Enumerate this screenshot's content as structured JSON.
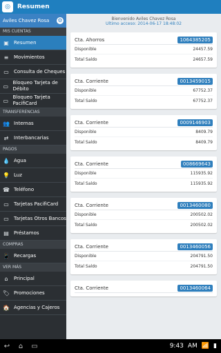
{
  "appbar": {
    "title": "Resumen",
    "logo_icon": "app-logo-icon"
  },
  "sidebar": {
    "user_name": "Aviles Chavez Rosa",
    "sections": [
      {
        "label": "MIS CUENTAS",
        "items": [
          {
            "label": "Resumen",
            "icon": "wallet-icon",
            "active": true
          },
          {
            "label": "Movimientos",
            "icon": "list-icon"
          },
          {
            "label": "Consulta de Cheques",
            "icon": "cheque-icon"
          },
          {
            "label": "Bloqueo Tarjeta de Débito",
            "icon": "card-icon"
          },
          {
            "label": "Bloqueo Tarjeta PacifiCard",
            "icon": "card-icon"
          }
        ]
      },
      {
        "label": "TRANSFERENCIAS",
        "items": [
          {
            "label": "Internas",
            "icon": "people-icon"
          },
          {
            "label": "Interbancarias",
            "icon": "transfer-icon"
          }
        ]
      },
      {
        "label": "PAGOS",
        "items": [
          {
            "label": "Agua",
            "icon": "drop-icon"
          },
          {
            "label": "Luz",
            "icon": "bulb-icon"
          },
          {
            "label": "Teléfono",
            "icon": "phone-icon"
          },
          {
            "label": "Tarjetas PacifiCard",
            "icon": "card-icon"
          },
          {
            "label": "Tarjetas Otros Bancos",
            "icon": "card-icon"
          },
          {
            "label": "Préstamos",
            "icon": "loan-icon"
          }
        ]
      },
      {
        "label": "COMPRAS",
        "items": [
          {
            "label": "Recargas",
            "icon": "mobile-icon"
          }
        ]
      },
      {
        "label": "VER MÁS",
        "items": [
          {
            "label": "Principal",
            "icon": "home-icon"
          },
          {
            "label": "Promociones",
            "icon": "tag-icon"
          },
          {
            "label": "Agencias y Cajeros",
            "icon": "house-icon"
          }
        ]
      }
    ]
  },
  "main": {
    "welcome": "Bienvenido Aviles Chavez Rosa",
    "last_access": "Ultimo acceso: 2014-06-17 18:48:02",
    "cards": [
      {
        "type": "Cta. Ahorros",
        "account": "1064385205",
        "disponible": "24457.59",
        "saldo": "24657.59"
      },
      {
        "type": "Cta. Corriente",
        "account": "0013459015",
        "disponible": "67752.37",
        "saldo": "67752.37"
      },
      {
        "type": "Cta. Corriente",
        "account": "0009146903",
        "disponible": "8409.79",
        "saldo": "8409.79"
      },
      {
        "type": "Cta. Corriente",
        "account": "008669643",
        "disponible": "115935.92",
        "saldo": "115935.92"
      },
      {
        "type": "Cta. Corriente",
        "account": "0013460080",
        "disponible": "200502.02",
        "saldo": "200502.02"
      },
      {
        "type": "Cta. Corriente",
        "account": "0013460056",
        "disponible": "204791.50",
        "saldo": "204791.50"
      },
      {
        "type": "Cta. Corriente",
        "account": "0013460064",
        "disponible": "",
        "saldo": ""
      }
    ],
    "labels": {
      "disponible": "Disponible",
      "saldo": "Total Saldo"
    }
  },
  "sysbar": {
    "time": "9:43",
    "ampm": "AM"
  }
}
